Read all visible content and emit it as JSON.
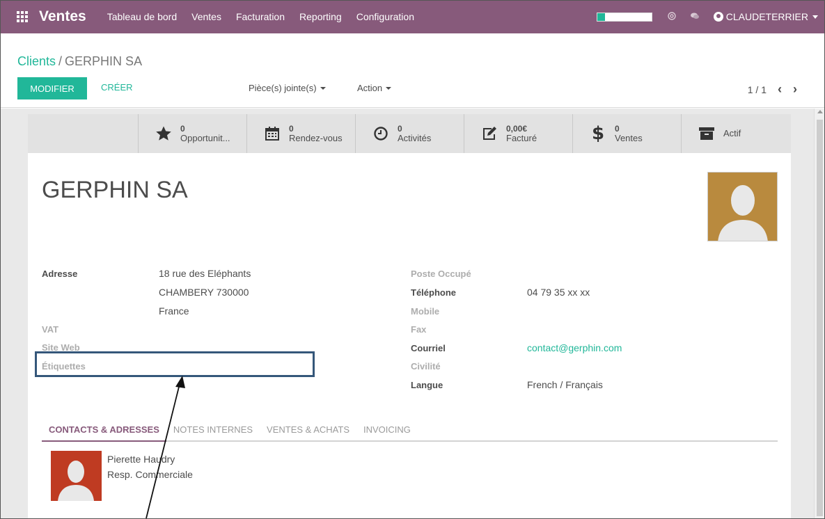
{
  "navbar": {
    "app_name": "Ventes",
    "menu": [
      "Tableau de bord",
      "Ventes",
      "Facturation",
      "Reporting",
      "Configuration"
    ],
    "progress": 0.14,
    "user_name": "CLAUDETERRIER",
    "icons": [
      "apps-grid-icon",
      "at-icon",
      "chat-icon",
      "user-avatar-icon",
      "caret-down-icon"
    ]
  },
  "control": {
    "breadcrumb_parent": "Clients",
    "breadcrumb_separator": "/",
    "breadcrumb_current": "GERPHIN SA",
    "edit_label": "MODIFIER",
    "create_label": "CRÉER",
    "attachments_label": "Pièce(s) jointe(s)",
    "action_label": "Action",
    "pager": "1 / 1"
  },
  "stats": [
    {
      "icon": "star-icon",
      "value": "0",
      "label": "Opportunit..."
    },
    {
      "icon": "calendar-icon",
      "value": "0",
      "label": "Rendez-vous"
    },
    {
      "icon": "clock-icon",
      "value": "0",
      "label": "Activités"
    },
    {
      "icon": "pencil-square-icon",
      "value": "0,00€",
      "label": "Facturé"
    },
    {
      "icon": "dollar-icon",
      "value": "0",
      "label": "Ventes"
    },
    {
      "icon": "archive-icon",
      "value": "",
      "label": "Actif"
    }
  ],
  "record": {
    "title": "GERPHIN SA",
    "fields_left": {
      "address_label": "Adresse",
      "address_line1": "18 rue des Eléphants",
      "address_line2": "CHAMBERY 730000",
      "address_line3": "France",
      "vat_label": "VAT",
      "website_label": "Site Web",
      "tags_label": "Étiquettes"
    },
    "fields_right": {
      "job_label": "Poste Occupé",
      "phone_label": "Téléphone",
      "phone_value": "04 79 35 xx xx",
      "mobile_label": "Mobile",
      "fax_label": "Fax",
      "email_label": "Courriel",
      "email_value": "contact@gerphin.com",
      "title_label": "Civilité",
      "lang_label": "Langue",
      "lang_value": "French / Français"
    }
  },
  "tabs": [
    "CONTACTS & ADRESSES",
    "NOTES INTERNES",
    "VENTES & ACHATS",
    "INVOICING"
  ],
  "contact": {
    "name": "Pierette Haudry",
    "role": "Resp. Commerciale"
  },
  "colors": {
    "brand": "#875a7b",
    "accent": "#21b799",
    "highlight_box": "#35577a"
  }
}
